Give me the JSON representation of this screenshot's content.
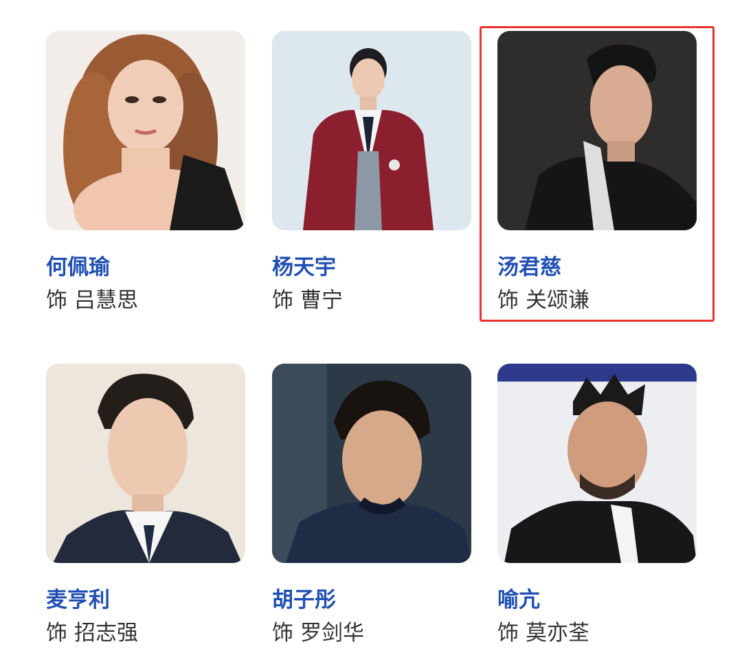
{
  "cast": [
    {
      "actor": "何佩瑜",
      "prefix": "饰",
      "role": "吕慧思",
      "photo_icon": "actor-photo"
    },
    {
      "actor": "杨天宇",
      "prefix": "饰",
      "role": "曹宁",
      "photo_icon": "actor-photo"
    },
    {
      "actor": "汤君慈",
      "prefix": "饰",
      "role": "关颂谦",
      "photo_icon": "actor-photo",
      "selected": true
    },
    {
      "actor": "麦亨利",
      "prefix": "饰",
      "role": "招志强",
      "photo_icon": "actor-photo"
    },
    {
      "actor": "胡子彤",
      "prefix": "饰",
      "role": "罗剑华",
      "photo_icon": "actor-photo"
    },
    {
      "actor": "喻亢",
      "prefix": "饰",
      "role": "莫亦荃",
      "photo_icon": "actor-photo"
    }
  ],
  "colors": {
    "actor_name": "#1f4fb2",
    "role_text": "#333333",
    "selection_border": "#e8322c"
  }
}
